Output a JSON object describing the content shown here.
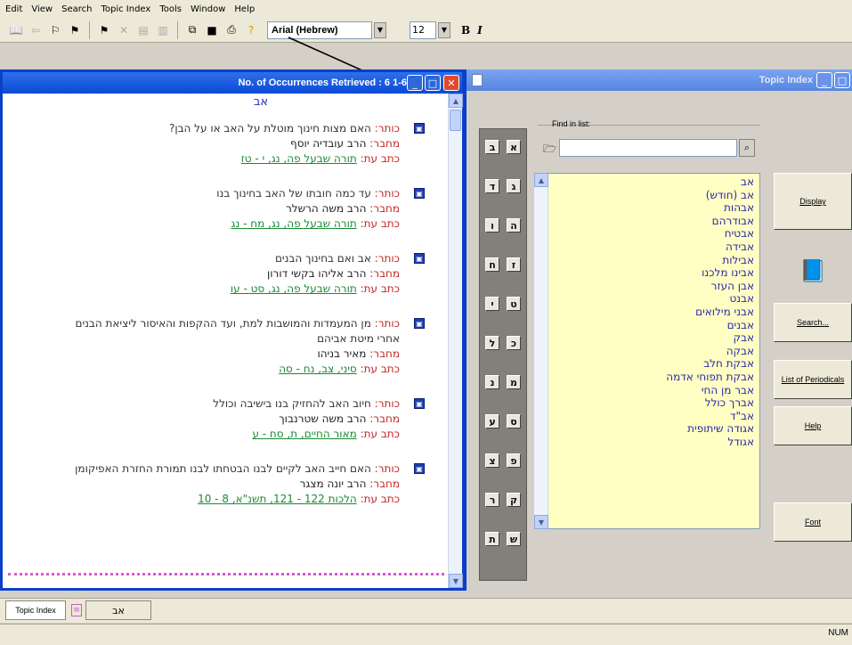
{
  "menu": [
    "Edit",
    "View",
    "Search",
    "Topic Index",
    "Tools",
    "Window",
    "Help"
  ],
  "toolbar": {
    "font_name": "Arial (Hebrew)",
    "font_size": "12",
    "bold": "B",
    "italic": "I"
  },
  "results_window": {
    "title": "No. of Occurrences Retrieved : 6    1-6",
    "term": "אב",
    "labels": {
      "title": "כותר:",
      "author": "מחבר:",
      "source": "כתב עת:"
    },
    "entries": [
      {
        "title": "האם מצות חינוך מוטלת על האב או על הבן?",
        "author": "הרב עובדיה יוסף",
        "source": "תורה שבעל פה, נג, י - טז"
      },
      {
        "title": "עד כמה חובתו של האב בחינוך בנו",
        "author": "הרב משה הרשלר",
        "source": "תורה שבעל פה, נג, מח - נג"
      },
      {
        "title": "אב ואם בחינוך הבנים",
        "author": "הרב אליהו בקשי דורון",
        "source": "תורה שבעל פה, נג, סט - עו"
      },
      {
        "title": "מן המעמדות והמושבות למת, ועד ההקפות והאיסור ליציאת הבנים",
        "title2": "אחרי מיטת אביהם",
        "author": "מאיר בניהו",
        "source": "סיני, צב, נח - סה"
      },
      {
        "title": "חיוב האב להחזיק בנו בישיבה וכולל",
        "author": "הרב משה שטרנבוך",
        "source": "מאור החיים, ת, סח - ע"
      },
      {
        "title": "האם חייב האב לקיים לבנו הבטחתו לבנו תמורת החזרת האפיקומן",
        "author": "הרב יונה מצגר",
        "source": "הלכות 122 - 121, תשנ\"א, 8 - 10"
      }
    ]
  },
  "topic_window": {
    "title": "Topic Index",
    "find_label": "Find in list:",
    "letters": [
      [
        "א",
        "ב"
      ],
      [
        "ג",
        "ד"
      ],
      [
        "ה",
        "ו"
      ],
      [
        "ז",
        "ח"
      ],
      [
        "ט",
        "י"
      ],
      [
        "כ",
        "ל"
      ],
      [
        "מ",
        "נ"
      ],
      [
        "ס",
        "ע"
      ],
      [
        "פ",
        "צ"
      ],
      [
        "ק",
        "ר"
      ],
      [
        "ש",
        "ת"
      ]
    ],
    "list": [
      "אב",
      "אב (חודש)",
      "אבהות",
      "אבודרהם",
      "אבטיח",
      "אבידה",
      "אבילות",
      "אבינו מלכנו",
      "אבן העזר",
      "אבנט",
      "אבני מילואים",
      "אבנים",
      "אבק",
      "אבקה",
      "אבקת חלב",
      "אבקת תפוחי אדמה",
      "אבר מן החי",
      "אברך כולל",
      "אב\"ד",
      "אגודה שיתופית",
      "אגודל"
    ],
    "buttons": {
      "display": "Display",
      "search": "Search...",
      "periodicals": "List of Periodicals",
      "help": "Help",
      "font": "Font"
    }
  },
  "tabs": {
    "topic_index": "Topic Index",
    "term_tab": "אב"
  },
  "status": {
    "num": "NUM"
  }
}
